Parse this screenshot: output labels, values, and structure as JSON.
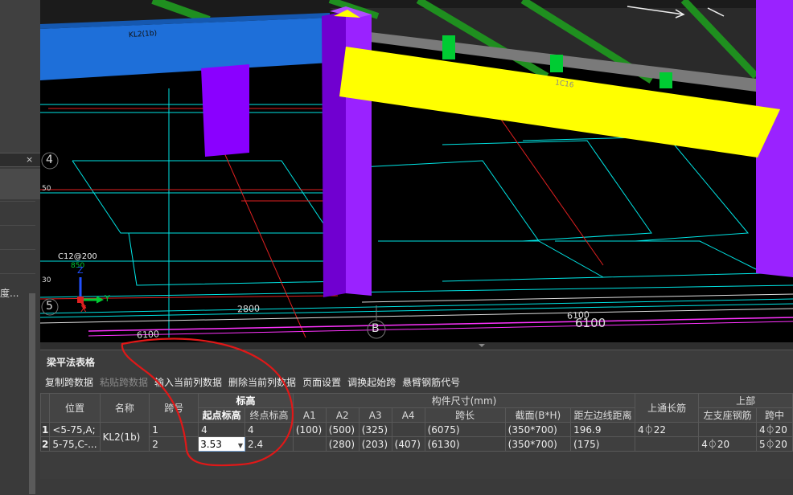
{
  "left_panel": {
    "close_label": "×",
    "truncated_text": "度..."
  },
  "viewport": {
    "axis_labels": {
      "row_4": "4",
      "row_5": "5",
      "col_B": "B"
    },
    "dims": {
      "d2800": "2800",
      "d6100": "6100",
      "d6100_small": "6100",
      "d6100_left": "6100"
    },
    "annotations": {
      "c_rebar": "C12@200",
      "val_850": "850",
      "val_50": "50",
      "val_30": "30",
      "beam_tag_1": "KL2(1b)",
      "beam_tag_2": "1C16"
    },
    "triad": {
      "x": "X",
      "y": "Y",
      "z": "Z"
    },
    "colors": {
      "blue_beam": "#1e6fd9",
      "yellow_beam": "#ffff00",
      "purple_col": "#8a00ff",
      "green_col": "#00cc33",
      "cyan_line": "#00e5e5",
      "red_line": "#e02020",
      "magenta_line": "#ff33ff",
      "white_line": "#dddddd"
    }
  },
  "panel": {
    "title": "梁平法表格",
    "toolbar": [
      {
        "label": "复制跨数据",
        "disabled": false
      },
      {
        "label": "粘贴跨数据",
        "disabled": true
      },
      {
        "label": "输入当前列数据",
        "disabled": false
      },
      {
        "label": "删除当前列数据",
        "disabled": false
      },
      {
        "label": "页面设置",
        "disabled": false
      },
      {
        "label": "调换起始跨",
        "disabled": false
      },
      {
        "label": "悬臂钢筋代号",
        "disabled": false
      }
    ],
    "headers": {
      "position": "位置",
      "name": "名称",
      "span_no": "跨号",
      "elevation": "标高",
      "start_elev": "起点标高",
      "end_elev": "终点标高",
      "dimensions": "构件尺寸(mm)",
      "a1": "A1",
      "a2": "A2",
      "a3": "A3",
      "a4": "A4",
      "span_len": "跨长",
      "section": "截面(B*H)",
      "edge_dist": "距左边线距离",
      "top_through": "上通长筋",
      "upper": "上部",
      "left_support": "左支座钢筋",
      "span_mid": "跨中"
    },
    "rows": [
      {
        "row_no": "1",
        "position": "<5-75,A;",
        "span_no": "1",
        "start_elev": "4",
        "end_elev": "4",
        "a1": "(100)",
        "a2": "(500)",
        "a3": "(325)",
        "a4": "",
        "span_len": "(6075)",
        "section": "(350*700)",
        "edge_dist": "196.9",
        "top_through": "4⏀22",
        "left_support": "",
        "span_mid": "4⏀20"
      },
      {
        "row_no": "2",
        "position": "5-75,C-...",
        "span_no": "2",
        "start_elev": "3.53",
        "end_elev": "2.4",
        "a1": "",
        "a2": "(280)",
        "a3": "(203)",
        "a4": "(407)",
        "span_len": "(6130)",
        "section": "(350*700)",
        "edge_dist": "(175)",
        "top_through": "",
        "left_support": "4⏀20",
        "span_mid": "5⏀20"
      }
    ],
    "name_merged": "KL2(1b)"
  }
}
